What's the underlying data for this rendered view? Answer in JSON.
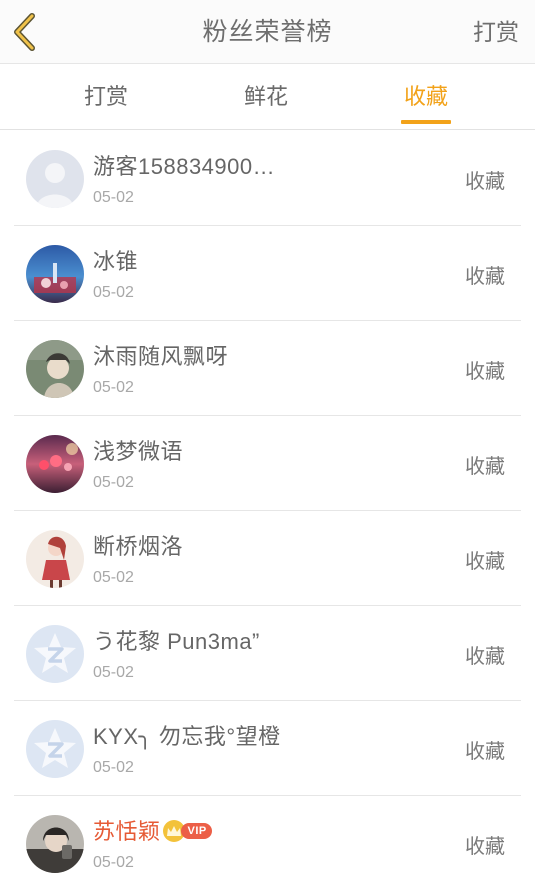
{
  "header": {
    "title": "粉丝荣誉榜",
    "action_label": "打赏"
  },
  "tabs": [
    {
      "label": "打赏",
      "active": false
    },
    {
      "label": "鲜花",
      "active": false
    },
    {
      "label": "收藏",
      "active": true
    }
  ],
  "colors": {
    "accent": "#f2a219",
    "vip_name": "#e65a35",
    "vip_badge": "#ec5f47"
  },
  "rows": [
    {
      "name": "游客158834900…",
      "date": "05-02",
      "action": "收藏",
      "avatar": "default-guest-avatar"
    },
    {
      "name": "冰锥",
      "date": "05-02",
      "action": "收藏",
      "avatar": "photo-avatar"
    },
    {
      "name": "沐雨随风飘呀",
      "date": "05-02",
      "action": "收藏",
      "avatar": "photo-avatar"
    },
    {
      "name": "浅梦微语",
      "date": "05-02",
      "action": "收藏",
      "avatar": "photo-avatar"
    },
    {
      "name": "断桥烟洛",
      "date": "05-02",
      "action": "收藏",
      "avatar": "photo-avatar"
    },
    {
      "name": "う花黎 Pun3ma”",
      "date": "05-02",
      "action": "收藏",
      "avatar": "default-star-avatar"
    },
    {
      "name": "KYX╮ 勿忘我°望橙",
      "date": "05-02",
      "action": "收藏",
      "avatar": "default-star-avatar"
    },
    {
      "name": "苏恬颖",
      "date": "05-02",
      "action": "收藏",
      "avatar": "photo-avatar",
      "vip_label": "VIP"
    }
  ]
}
